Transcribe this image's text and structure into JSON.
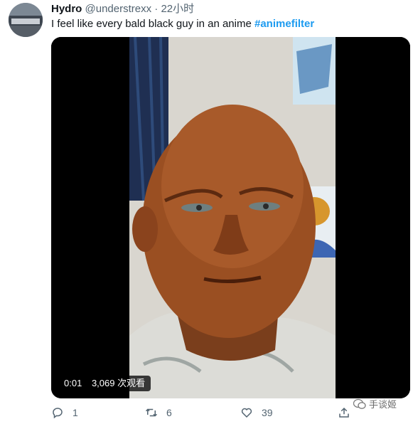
{
  "tweet": {
    "author_name": "Hydro",
    "author_handle": "@understrexx",
    "separator": "·",
    "time": "22小时",
    "text": "I feel like every bald black guy in an anime",
    "hashtag": "#animefilter"
  },
  "video": {
    "duration": "0:01",
    "views": "3,069 次观看"
  },
  "actions": {
    "replies": "1",
    "retweets": "6",
    "likes": "39"
  },
  "watermark": {
    "text": "手谈姬"
  },
  "colors": {
    "accent": "#1d9bf0",
    "text": "#0f1419",
    "secondary": "#536471"
  },
  "icons": [
    "reply-icon",
    "retweet-icon",
    "like-icon",
    "share-icon",
    "wechat-icon"
  ]
}
